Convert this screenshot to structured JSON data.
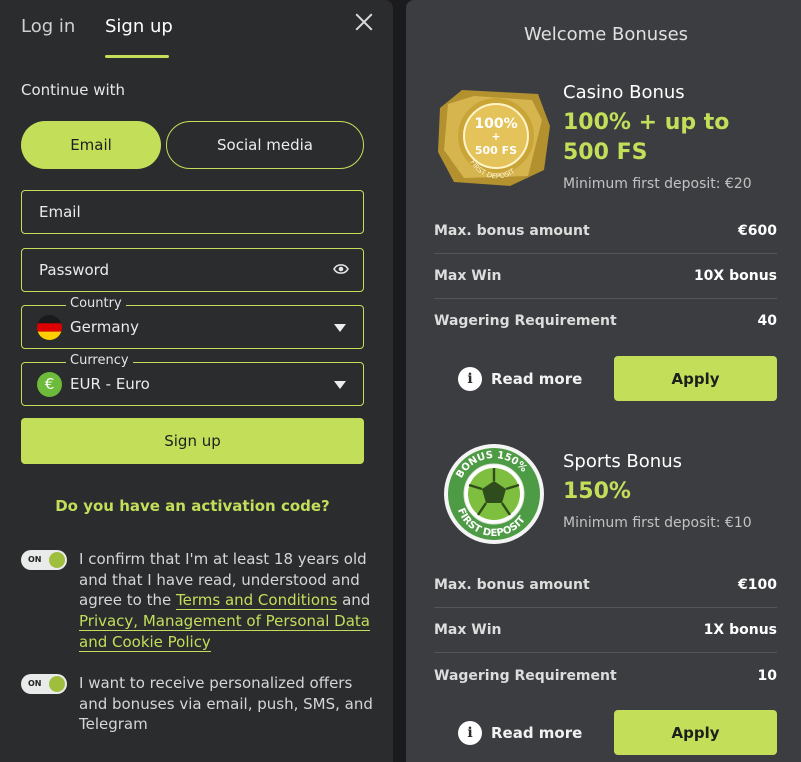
{
  "auth": {
    "tabs": [
      {
        "label": "Log in"
      },
      {
        "label": "Sign up"
      }
    ],
    "continue_with": "Continue with",
    "methods": {
      "email": "Email",
      "social": "Social media"
    },
    "fields": {
      "email_placeholder": "Email",
      "password_placeholder": "Password",
      "country_legend": "Country",
      "country_value": "Germany",
      "currency_legend": "Currency",
      "currency_value": "EUR - Euro",
      "currency_symbol": "€"
    },
    "signup_button": "Sign up",
    "activation_link": "Do you have an activation code?",
    "consent1": {
      "toggle_label": "ON",
      "text_before": "I confirm that I'm at least 18 years old and that I have read, understood and agree to the ",
      "terms_link": "Terms and Conditions",
      "text_and": " and ",
      "privacy_link": "Privacy, Management of Personal Data and Cookie Policy"
    },
    "consent2": {
      "toggle_label": "ON",
      "text": "I want to receive personalized offers and bonuses via email, push, SMS, and Telegram"
    }
  },
  "bonuses": {
    "title": "Welcome Bonuses",
    "items": [
      {
        "name": "Casino Bonus",
        "amount": "100% + up to 500 FS",
        "min_deposit": "Minimum first deposit: €20",
        "badge_line1": "100%",
        "badge_line2": "+",
        "badge_line3": "500 FS",
        "badge_arc": "FIRST DEPOSIT",
        "rows": [
          {
            "label": "Max. bonus amount",
            "value": "€600"
          },
          {
            "label": "Max Win",
            "value": "10X bonus"
          },
          {
            "label": "Wagering Requirement",
            "value": "40"
          }
        ],
        "read_more": "Read more",
        "apply": "Apply"
      },
      {
        "name": "Sports Bonus",
        "amount": "150%",
        "min_deposit": "Minimum first deposit: €10",
        "badge_top": "BONUS 150%",
        "badge_bottom": "FIRST DEPOSIT",
        "rows": [
          {
            "label": "Max. bonus amount",
            "value": "€100"
          },
          {
            "label": "Max Win",
            "value": "1X bonus"
          },
          {
            "label": "Wagering Requirement",
            "value": "10"
          }
        ],
        "read_more": "Read more",
        "apply": "Apply"
      }
    ]
  },
  "colors": {
    "accent": "#c3df5a",
    "left_bg": "#2b2c2e",
    "right_bg": "#3b3d40"
  },
  "icons": [
    "close-icon",
    "eye-icon",
    "germany-flag-icon",
    "euro-icon",
    "chevron-down-icon",
    "info-icon",
    "casino-badge-icon",
    "soccer-ball-badge-icon"
  ]
}
